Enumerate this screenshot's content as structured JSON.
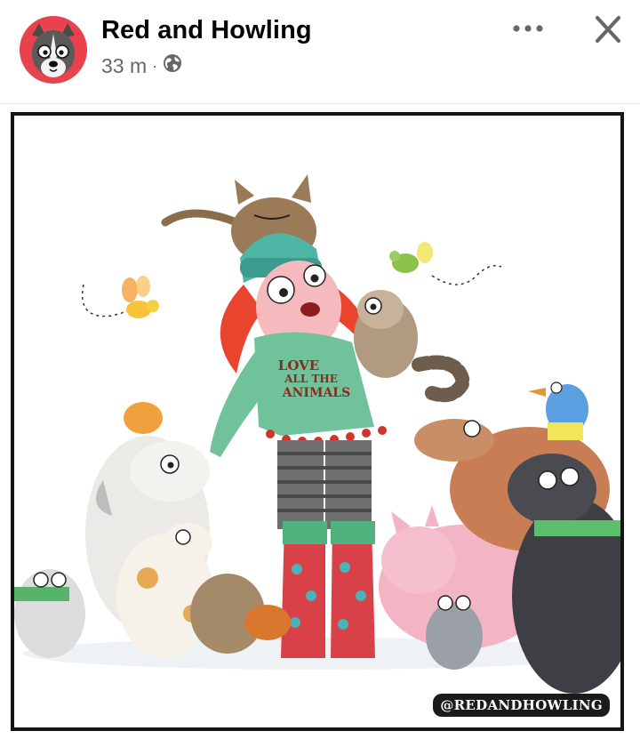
{
  "post": {
    "author": "Red and Howling",
    "time": "33 m",
    "separator": "·",
    "privacy_icon": "globe-icon",
    "more_icon": "more-dots-icon",
    "close_icon": "close-icon"
  },
  "image": {
    "shirt_line1": "LOVE",
    "shirt_line2": "ALL THE",
    "shirt_line3": "ANIMALS",
    "watermark": "@REDANDHOWLING"
  },
  "colors": {
    "avatar_bg": "#e8424f",
    "secondary_text": "#65676b",
    "frame": "#151515"
  }
}
